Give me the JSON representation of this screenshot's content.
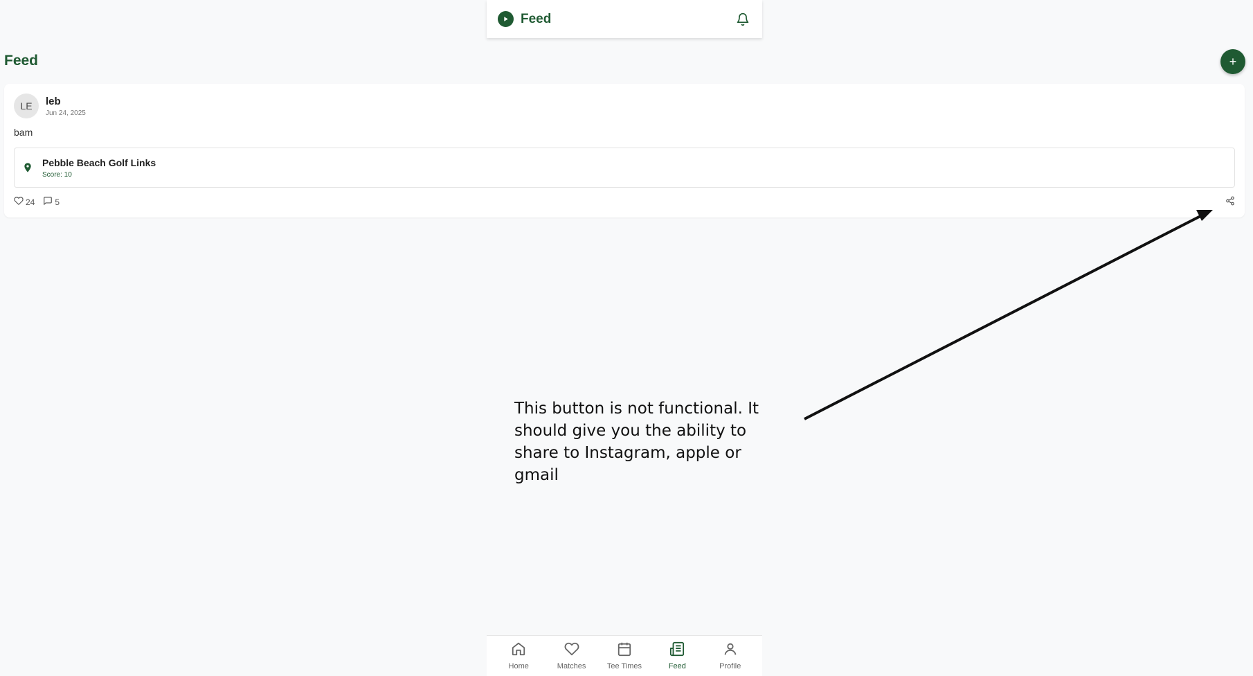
{
  "header": {
    "title": "Feed",
    "brand_icon": "play-circle-icon",
    "notification_icon": "bell-icon"
  },
  "page": {
    "title": "Feed",
    "add_label": "+"
  },
  "post": {
    "avatar_initials": "LE",
    "author": "leb",
    "date": "Jun 24, 2025",
    "body": "bam",
    "course": {
      "name": "Pebble Beach Golf Links",
      "score": "Score: 10",
      "icon": "location-pin-icon"
    },
    "likes": "24",
    "comments": "5",
    "share_icon": "share-icon"
  },
  "annotation": {
    "text": "This button is not functional. It should give you the ability to share to Instagram, apple or gmail"
  },
  "nav": {
    "items": [
      {
        "label": "Home",
        "icon": "home-icon"
      },
      {
        "label": "Matches",
        "icon": "heart-icon"
      },
      {
        "label": "Tee Times",
        "icon": "calendar-icon"
      },
      {
        "label": "Feed",
        "icon": "newspaper-icon",
        "active": true
      },
      {
        "label": "Profile",
        "icon": "user-icon"
      }
    ]
  },
  "colors": {
    "brand": "#1f5a32",
    "background": "#f8f9fa"
  }
}
